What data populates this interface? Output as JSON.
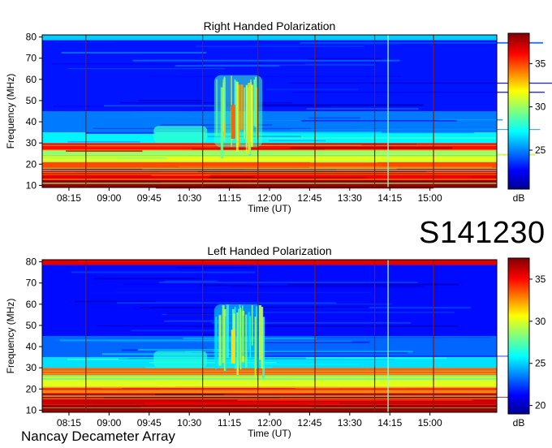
{
  "event_id": "S141230",
  "footer": "Nancay Decameter Array",
  "chart_data": [
    {
      "type": "heatmap",
      "title": "Right Handed Polarization",
      "xlabel": "Time (UT)",
      "ylabel": "Frequency (MHz)",
      "x_ticks": [
        "08:15",
        "09:00",
        "09:45",
        "10:30",
        "11:15",
        "12:00",
        "12:45",
        "13:30",
        "14:15",
        "15:00"
      ],
      "x_range_minutes": [
        465,
        975
      ],
      "y_ticks": [
        10,
        20,
        30,
        40,
        50,
        60,
        70,
        80
      ],
      "ylim": [
        9,
        81
      ],
      "colorbar": {
        "label": "dB",
        "ticks": [
          25,
          30,
          35
        ],
        "range": [
          20.5,
          38.5
        ]
      },
      "bands": [
        {
          "f_min": 9,
          "f_max": 12.5,
          "level": 0.97
        },
        {
          "f_min": 12.5,
          "f_max": 18,
          "level": 0.9
        },
        {
          "f_min": 18,
          "f_max": 21,
          "level": 0.8
        },
        {
          "f_min": 21,
          "f_max": 24.5,
          "level": 0.6
        },
        {
          "f_min": 24.5,
          "f_max": 26.5,
          "level": 0.52
        },
        {
          "f_min": 26.5,
          "f_max": 30,
          "level": 0.86
        },
        {
          "f_min": 30,
          "f_max": 35,
          "level": 0.36
        },
        {
          "f_min": 35,
          "f_max": 45,
          "level": 0.24
        },
        {
          "f_min": 45,
          "f_max": 78.5,
          "level": 0.14
        },
        {
          "f_min": 78.5,
          "f_max": 81,
          "level": 0.32
        }
      ],
      "burst": {
        "t_start": 658,
        "t_end": 712,
        "f_min": 28,
        "f_max": 62,
        "peak_level": 0.72
      },
      "glow": {
        "t_start": 590,
        "t_end": 650,
        "f_min": 30,
        "f_max": 38,
        "level": 0.42
      },
      "dark_lines": [
        514,
        645,
        707,
        771,
        838,
        904
      ],
      "light_lines": [
        853
      ]
    },
    {
      "type": "heatmap",
      "title": "Left Handed Polarization",
      "xlabel": "Time (UT)",
      "ylabel": "Frequency (MHz)",
      "x_ticks": [
        "08:15",
        "09:00",
        "09:45",
        "10:30",
        "11:15",
        "12:00",
        "12:45",
        "13:30",
        "14:15",
        "15:00"
      ],
      "x_range_minutes": [
        465,
        975
      ],
      "y_ticks": [
        10,
        20,
        30,
        40,
        50,
        60,
        70,
        80
      ],
      "ylim": [
        9,
        81
      ],
      "colorbar": {
        "label": "dB",
        "ticks": [
          20,
          25,
          30,
          35
        ],
        "range": [
          19,
          37.5
        ]
      },
      "bands": [
        {
          "f_min": 9,
          "f_max": 12.5,
          "level": 0.97
        },
        {
          "f_min": 12.5,
          "f_max": 18,
          "level": 0.92
        },
        {
          "f_min": 18,
          "f_max": 21,
          "level": 0.82
        },
        {
          "f_min": 21,
          "f_max": 24.5,
          "level": 0.6
        },
        {
          "f_min": 24.5,
          "f_max": 26.5,
          "level": 0.5
        },
        {
          "f_min": 26.5,
          "f_max": 30,
          "level": 0.78
        },
        {
          "f_min": 30,
          "f_max": 35,
          "level": 0.34
        },
        {
          "f_min": 35,
          "f_max": 45,
          "level": 0.22
        },
        {
          "f_min": 45,
          "f_max": 78.5,
          "level": 0.13
        },
        {
          "f_min": 78.5,
          "f_max": 81,
          "level": 0.9
        }
      ],
      "burst": {
        "t_start": 658,
        "t_end": 712,
        "f_min": 30,
        "f_max": 60,
        "peak_level": 0.6
      },
      "glow": {
        "t_start": 590,
        "t_end": 650,
        "f_min": 30,
        "f_max": 38,
        "level": 0.4
      },
      "dark_lines": [
        514,
        645,
        707,
        771,
        838,
        904
      ],
      "light_lines": [
        853
      ]
    }
  ]
}
